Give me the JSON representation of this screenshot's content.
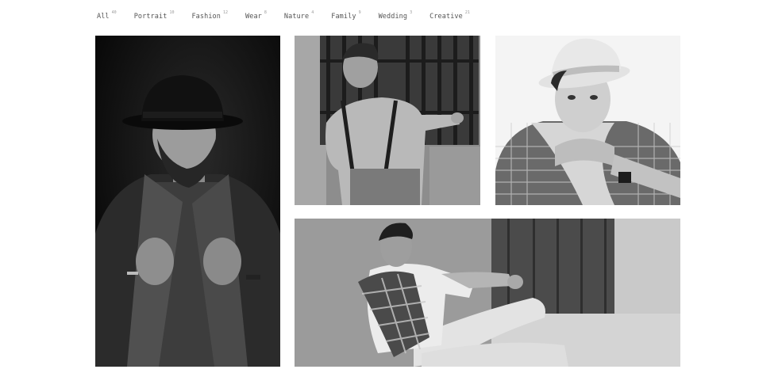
{
  "filters": [
    {
      "label": "All",
      "count": "40"
    },
    {
      "label": "Portrait",
      "count": "10"
    },
    {
      "label": "Fashion",
      "count": "12"
    },
    {
      "label": "Wear",
      "count": "8"
    },
    {
      "label": "Nature",
      "count": "4"
    },
    {
      "label": "Family",
      "count": "9"
    },
    {
      "label": "Wedding",
      "count": "3"
    },
    {
      "label": "Creative",
      "count": "21"
    }
  ],
  "colors": {
    "background": "#ffffff",
    "filter_text": "#555555",
    "filter_count": "#9a9a9a"
  }
}
